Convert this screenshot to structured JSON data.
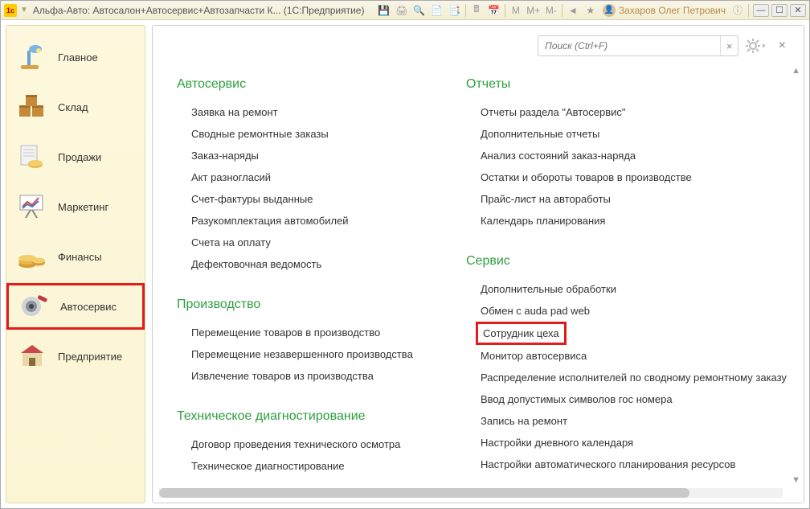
{
  "title": "Альфа-Авто: Автосалон+Автосервис+Автозапчасти К...  (1С:Предприятие)",
  "user_name": "Захаров Олег Петрович",
  "toolbar_letters": {
    "m": "M",
    "mplus": "M+",
    "mminus": "M-"
  },
  "search": {
    "placeholder": "Поиск (Ctrl+F)"
  },
  "sidebar": {
    "items": [
      {
        "label": "Главное"
      },
      {
        "label": "Склад"
      },
      {
        "label": "Продажи"
      },
      {
        "label": "Маркетинг"
      },
      {
        "label": "Финансы"
      },
      {
        "label": "Автосервис"
      },
      {
        "label": "Предприятие"
      }
    ]
  },
  "content": {
    "left": {
      "sections": [
        {
          "title": "Автосервис",
          "items": [
            "Заявка на ремонт",
            "Сводные ремонтные заказы",
            "Заказ-наряды",
            "Акт разногласий",
            "Счет-фактуры выданные",
            "Разукомплектация автомобилей",
            "Счета на оплату",
            "Дефектовочная ведомость"
          ]
        },
        {
          "title": "Производство",
          "items": [
            "Перемещение товаров в производство",
            "Перемещение незавершенного производства",
            "Извлечение товаров из производства"
          ]
        },
        {
          "title": "Техническое диагностирование",
          "items": [
            "Договор проведения технического осмотра",
            "Техническое диагностирование"
          ]
        }
      ]
    },
    "right": {
      "sections": [
        {
          "title": "Отчеты",
          "items": [
            "Отчеты раздела \"Автосервис\"",
            "Дополнительные отчеты",
            "Анализ состояний заказ-наряда",
            "Остатки и обороты товаров в производстве",
            "Прайс-лист на автоработы",
            "Календарь планирования"
          ]
        },
        {
          "title": "Сервис",
          "items": [
            "Дополнительные обработки",
            "Обмен с auda pad web",
            "Сотрудник цеха",
            "Монитор автосервиса",
            "Распределение исполнителей по сводному ремонтному заказу",
            "Ввод допустимых символов гос номера",
            "Запись на ремонт",
            "Настройки дневного календаря",
            "Настройки автоматического планирования ресурсов"
          ],
          "highlight_index": 2
        }
      ]
    }
  }
}
